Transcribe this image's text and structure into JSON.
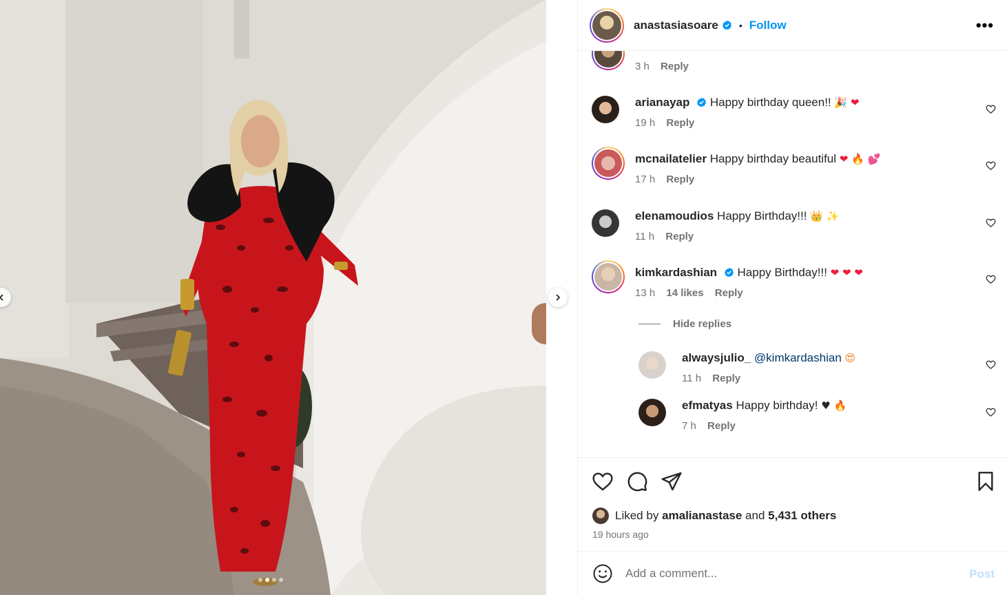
{
  "post": {
    "author": "anastasiasoare",
    "separator": "•",
    "follow_label": "Follow",
    "more_label": "•••",
    "image_alt": "Woman in red leopard print gown with black feather shoulders standing by a white curved staircase",
    "carousel": {
      "slide_count": 4,
      "active_index": 1
    }
  },
  "comments": [
    {
      "user": "",
      "text": "",
      "time": "3 h",
      "likes": "",
      "reply": "Reply",
      "partial": true
    },
    {
      "user": "arianayap",
      "verified": true,
      "text": "Happy birthday queen!!",
      "emojis": [
        "🎉",
        "❤"
      ],
      "time": "19 h",
      "likes": "",
      "reply": "Reply"
    },
    {
      "user": "mcnailatelier",
      "verified": false,
      "text": "Happy birthday beautiful",
      "emojis": [
        "❤",
        "🔥",
        "💕"
      ],
      "time": "17 h",
      "likes": "",
      "reply": "Reply"
    },
    {
      "user": "elenamoudios",
      "verified": false,
      "text": "Happy Birthday!!!",
      "emojis": [
        "👑",
        "✨"
      ],
      "time": "11 h",
      "likes": "",
      "reply": "Reply"
    },
    {
      "user": "kimkardashian",
      "verified": true,
      "text": "Happy Birthday!!!",
      "emojis": [
        "❤",
        "❤",
        "❤"
      ],
      "time": "13 h",
      "likes": "14 likes",
      "reply": "Reply"
    }
  ],
  "hide_replies_label": "Hide replies",
  "replies": [
    {
      "user": "alwaysjulio_",
      "mention": "@kimkardashian",
      "text": "",
      "emojis": [
        "😍"
      ],
      "time": "11 h",
      "reply": "Reply"
    },
    {
      "user": "efmatyas",
      "mention": "",
      "text": "Happy birthday!",
      "emojis": [
        "♥",
        "🔥"
      ],
      "time": "7 h",
      "reply": "Reply"
    }
  ],
  "likes": {
    "prefix": "Liked by",
    "user": "amalianastase",
    "connector": "and",
    "others": "5,431 others"
  },
  "time_ago": "19 hours ago",
  "add_comment": {
    "placeholder": "Add a comment...",
    "post_label": "Post"
  },
  "colors": {
    "accent": "#0095f6",
    "verified": "#0095f6",
    "post_disabled": "#c2e0fd",
    "secondary_text": "#737373"
  },
  "icons": [
    "chevron-left-icon",
    "chevron-right-icon",
    "verified-badge-icon",
    "more-icon",
    "heart-icon",
    "comment-icon",
    "share-icon",
    "bookmark-icon",
    "smile-icon"
  ]
}
